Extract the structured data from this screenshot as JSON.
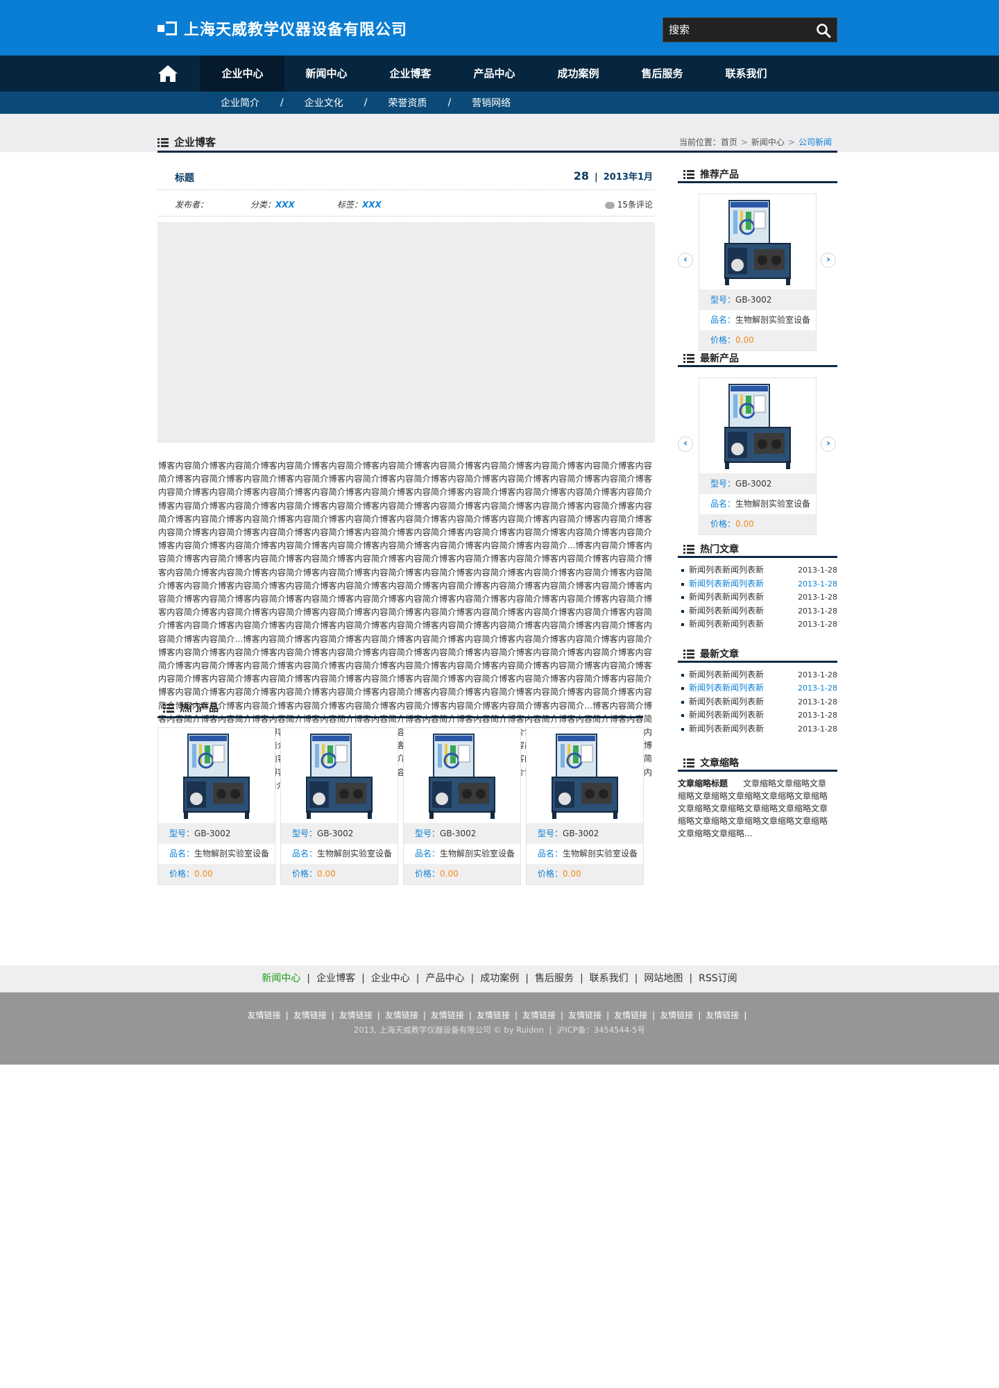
{
  "header": {
    "company": "上海天威教学仪器设备有限公司",
    "search_placeholder": "搜索"
  },
  "nav": {
    "items": [
      "企业中心",
      "新闻中心",
      "企业博客",
      "产品中心",
      "成功案例",
      "售后服务",
      "联系我们"
    ],
    "active": "企业中心"
  },
  "subnav": [
    "企业简介",
    "企业文化",
    "荣誉资质",
    "营销网络"
  ],
  "section_title": "企业博客",
  "breadcrumb": {
    "label": "当前位置：",
    "items": [
      "首页",
      "新闻中心",
      "公司新闻"
    ]
  },
  "post": {
    "title": "标题",
    "day": "28",
    "year_month": "2013年1月",
    "author_label": "发布者：",
    "category_label": "分类：",
    "category_value": "XXX",
    "tag_label": "标签：",
    "tag_value": "XXX",
    "comments": "15条评论",
    "body": "博客内容简介博客内容简介博客内容简介博客内容简介博客内容简介博客内容简介博客内容简介博客内容简介博客内容简介博客内容简介博客内容简介博客内容简介博客内容简介博客内容简介博客内容简介博客内容简介博客内容简介博客内容简介博客内容简介博客内容简介博客内容简介博客内容简介博客内容简介博客内容简介博客内容简介博客内容简介博客内容简介博客内容简介博客内容简介博客内容简介博客内容简介博客内容简介博客内容简介博客内容简介博客内容简介博客内容简介博客内容简介博客内容简介博客内容简介博客内容简介博客内容简介博客内容简介博客内容简介博客内容简介博客内容简介博客内容简介博客内容简介博客内容简介博客内容简介博客内容简介博客内容简介博客内容简介博客内容简介博客内容简介博客内容简介博客内容简介博客内容简介博客内容简介博客内容简介博客内容简介博客内容简介博客内容简介博客内容简介博客内容简介博客内容简介博客内容简介...博客内容简介博客内容简介博客内容简介博客内容简介博客内容简介博客内容简介博客内容简介博客内容简介博客内容简介博客内容简介博客内容简介博客内容简介博客内容简介博客内容简介博客内容简介博客内容简介博客内容简介博客内容简介博客内容简介博客内容简介博客内容简介博客内容简介博客内容简介博客内容简介博客内容简介博客内容简介博客内容简介博客内容简介博客内容简介博客内容简介博客内容简介博客内容简介博客内容简介博客内容简介博客内容简介博客内容简介博客内容简介博客内容简介博客内容简介博客内容简介博客内容简介博客内容简介博客内容简介博客内容简介博客内容简介博客内容简介博客内容简介博客内容简介博客内容简介博客内容简介博客内容简介博客内容简介博客内容简介博客内容简介博客内容简介博客内容简介博客内容简介博客内容简介博客内容简介博客内容简介博客内容简介...博客内容简介博客内容简介博客内容简介博客内容简介博客内容简介博客内容简介博客内容简介博客内容简介博客内容简介博客内容简介博客内容简介博客内容简介博客内容简介博客内容简介博客内容简介博客内容简介博客内容简介博客内容简介博客内容简介博客内容简介博客内容简介博客内容简介博客内容简介博客内容简介博客内容简介博客内容简介博客内容简介博客内容简介博客内容简介博客内容简介博客内容简介博客内容简介博客内容简介博客内容简介博客内容简介博客内容简介博客内容简介博客内容简介博客内容简介博客内容简介博客内容简介博客内容简介博客内容简介博客内容简介博客内容简介博客内容简介博客内容简介博客内容简介博客内容简介博客内容简介博客内容简介博客内容简介博客内容简介博客内容简介博客内容简介...博客内容简介博客内容简介博客内容简介博客内容简介博客内容简介博客内容简介博客内容简介博客内容简介博客内容简介博客内容简介博客内容简介博客内容简介博客内容简介博客内容简介博客内容简介博客内容简介博客内容简介博客内容简介博客内容简介博客内容简介博客内容简介博客内容简介博客内容简介博客内容简介博客内容简介博客内容简介博客内容简介博客内容简介博客内容简介博客内容简介博客内容简介博客内容简介博客内容简介博客内容简介博客内容简介博客内容简介博客内容简介博客内容简介博客内容简介博客内容简介博客内容简介博客内容简介博客内容简介博客内容简介博客内容简介博客内容简介博客内容简介博客内容简介博客内容简介博客内容简介博客内容简介博客内容简介..."
  },
  "hot_products": {
    "title": "热门产品",
    "items": [
      {
        "model_label": "型号：",
        "model": "GB-3002",
        "name_label": "品名：",
        "name": "生物解剖实验室设备",
        "price_label": "价格：",
        "price": "0.00"
      },
      {
        "model_label": "型号：",
        "model": "GB-3002",
        "name_label": "品名：",
        "name": "生物解剖实验室设备",
        "price_label": "价格：",
        "price": "0.00"
      },
      {
        "model_label": "型号：",
        "model": "GB-3002",
        "name_label": "品名：",
        "name": "生物解剖实验室设备",
        "price_label": "价格：",
        "price": "0.00"
      },
      {
        "model_label": "型号：",
        "model": "GB-3002",
        "name_label": "品名：",
        "name": "生物解剖实验室设备",
        "price_label": "价格：",
        "price": "0.00"
      }
    ]
  },
  "sidebar": {
    "recommended": {
      "title": "推荐产品",
      "item": {
        "model_label": "型号：",
        "model": "GB-3002",
        "name_label": "品名：",
        "name": "生物解剖实验室设备",
        "price_label": "价格：",
        "price": "0.00"
      }
    },
    "latest_products": {
      "title": "最新产品",
      "item": {
        "model_label": "型号：",
        "model": "GB-3002",
        "name_label": "品名：",
        "name": "生物解剖实验室设备",
        "price_label": "价格：",
        "price": "0.00"
      }
    },
    "hot_articles": {
      "title": "热门文章",
      "items": [
        {
          "title": "新闻列表新闻列表新",
          "date": "2013-1-28"
        },
        {
          "title": "新闻列表新闻列表新",
          "date": "2013-1-28"
        },
        {
          "title": "新闻列表新闻列表新",
          "date": "2013-1-28"
        },
        {
          "title": "新闻列表新闻列表新",
          "date": "2013-1-28"
        },
        {
          "title": "新闻列表新闻列表新",
          "date": "2013-1-28"
        }
      ]
    },
    "latest_articles": {
      "title": "最新文章",
      "items": [
        {
          "title": "新闻列表新闻列表新",
          "date": "2013-1-28"
        },
        {
          "title": "新闻列表新闻列表新",
          "date": "2013-1-28"
        },
        {
          "title": "新闻列表新闻列表新",
          "date": "2013-1-28"
        },
        {
          "title": "新闻列表新闻列表新",
          "date": "2013-1-28"
        },
        {
          "title": "新闻列表新闻列表新",
          "date": "2013-1-28"
        }
      ]
    },
    "abstract": {
      "title": "文章缩略",
      "heading": "文章缩略标题",
      "text": "文章缩略文章缩略文章缩略文章缩略文章缩略文章缩略文章缩略文章缩略文章缩略文章缩略文章缩略文章缩略文章缩略文章缩略文章缩略文章缩略文章缩略文章缩略..."
    }
  },
  "footer": {
    "nav": [
      "新闻中心",
      "企业博客",
      "企业中心",
      "产品中心",
      "成功案例",
      "售后服务",
      "联系我们",
      "网站地图",
      "RSS订阅"
    ],
    "friend_links": [
      "友情链接",
      "友情链接",
      "友情链接",
      "友情链接",
      "友情链接",
      "友情链接",
      "友情链接",
      "友情链接",
      "友情链接",
      "友情链接",
      "友情链接"
    ],
    "copyright": "2013, 上海天威教学仪器设备有限公司 © by Ruidon",
    "icp": "沪ICP备：3454544-5号"
  },
  "colors": {
    "brand_blue": "#0a7ed4",
    "nav_dark": "#06263f",
    "subnav_blue": "#0b4a78",
    "price_orange": "#f08a1c"
  }
}
